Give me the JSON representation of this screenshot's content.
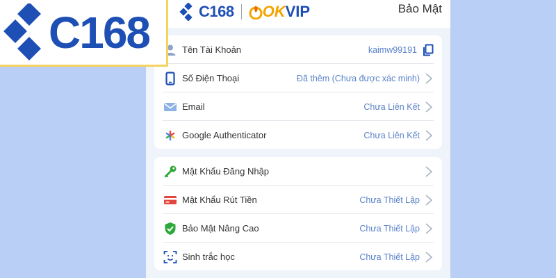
{
  "logo": {
    "text": "C168"
  },
  "header": {
    "brand_c168": "C168",
    "brand_ok": "OK",
    "brand_vip": "VIP",
    "title": "Bảo Mật"
  },
  "account": {
    "rows": [
      {
        "icon": "user-icon",
        "label": "Tên Tài Khoản",
        "value": "kaimw99191"
      },
      {
        "icon": "phone-icon",
        "label": "Số Điện Thoại",
        "value": "Đã thêm (Chưa được xác minh)"
      },
      {
        "icon": "email-icon",
        "label": "Email",
        "value": "Chưa Liên Kết"
      },
      {
        "icon": "google-authenticator-icon",
        "label": "Google Authenticator",
        "value": "Chưa Liên Kết"
      }
    ]
  },
  "security": {
    "rows": [
      {
        "icon": "key-icon",
        "label": "Mật Khẩu Đăng Nhập",
        "value": ""
      },
      {
        "icon": "card-icon",
        "label": "Mật Khẩu Rút Tiền",
        "value": "Chưa Thiết Lập"
      },
      {
        "icon": "shield-icon",
        "label": "Bảo Mật Nâng Cao",
        "value": "Chưa Thiết Lập"
      },
      {
        "icon": "face-scan-icon",
        "label": "Sinh trắc học",
        "value": "Chưa Thiết Lập"
      }
    ]
  },
  "colors": {
    "background": "#b9cff5",
    "brand_blue": "#1d4fb5",
    "value_blue": "#5b83c9",
    "key_green": "#2fa83a",
    "card_red": "#e2453c"
  }
}
